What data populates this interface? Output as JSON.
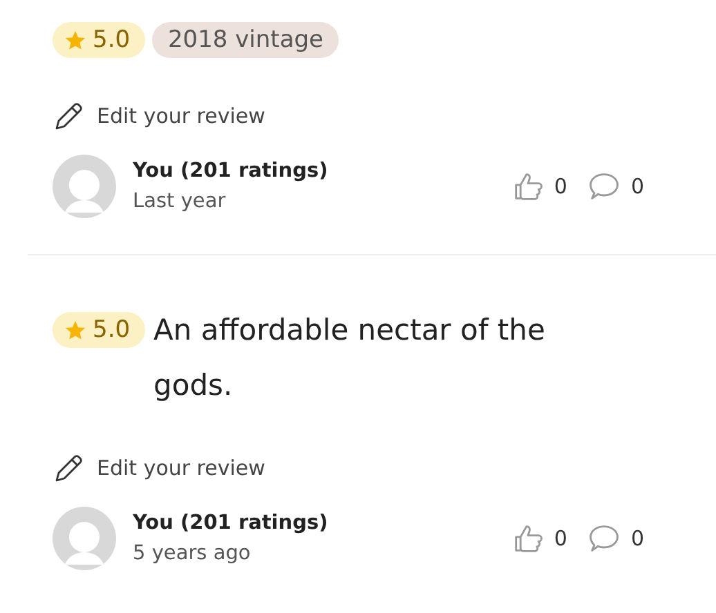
{
  "reviews": [
    {
      "tags": [
        {
          "kind": "rating",
          "text": "5.0"
        },
        {
          "kind": "vintage",
          "text": "2018 vintage"
        }
      ],
      "edit_link": "Edit your review",
      "user": "You (201 ratings)",
      "time": "Last year",
      "likes": "0",
      "comments": "0"
    },
    {
      "tags": [
        {
          "kind": "rating",
          "text": "5.0"
        }
      ],
      "text": "An affordable nectar of the gods.",
      "edit_link": "Edit your review",
      "user": "You (201 ratings)",
      "time": "5 years ago",
      "likes": "0",
      "comments": "0"
    }
  ]
}
